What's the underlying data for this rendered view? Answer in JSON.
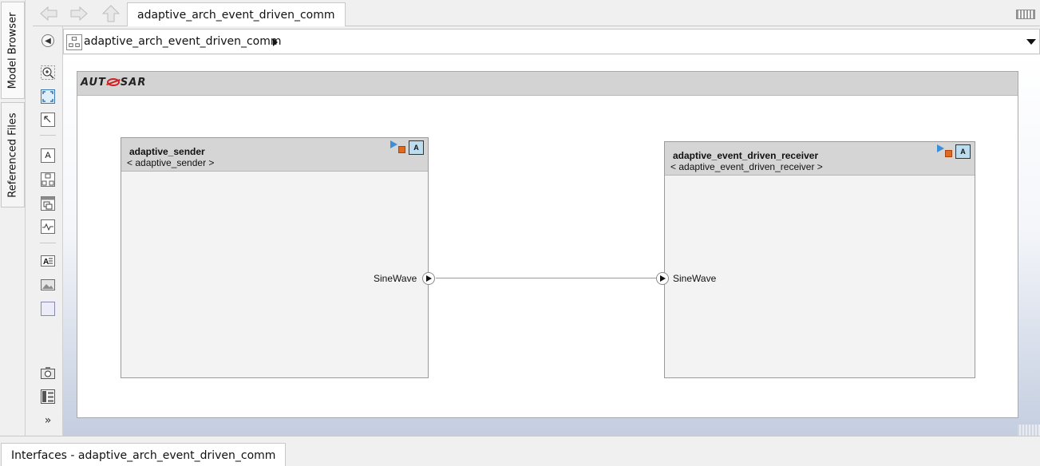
{
  "side_tabs": {
    "model_browser": "Model Browser",
    "referenced_files": "Referenced Files"
  },
  "toolbar": {
    "active_tab": "adaptive_arch_event_driven_comm",
    "nav_icons": [
      "back-arrow-icon",
      "forward-arrow-icon",
      "up-arrow-icon"
    ],
    "right_icon": "keyboard-icon"
  },
  "address_bar": {
    "path": "adaptive_arch_event_driven_comm",
    "model_icon": "model-icon"
  },
  "palette": {
    "tools": [
      "zoom-in-icon",
      "fit-to-view-icon",
      "zoom-normal-icon",
      "annotation-icon",
      "component-icon",
      "reference-component-icon",
      "adapter-icon",
      "image-annotation-icon",
      "area-image-icon",
      "area-icon",
      "screenshot-icon",
      "property-inspector-icon",
      "expand-chevron-icon"
    ]
  },
  "canvas": {
    "header_logo": "AUTOSAR",
    "components": [
      {
        "name": "adaptive_sender",
        "type": "< adaptive_sender >",
        "ports": [
          {
            "label": "SineWave",
            "direction": "out"
          }
        ]
      },
      {
        "name": "adaptive_event_driven_receiver",
        "type": "< adaptive_event_driven_receiver >",
        "ports": [
          {
            "label": "SineWave",
            "direction": "in"
          }
        ]
      }
    ],
    "component_badge": "A",
    "connections": [
      {
        "from": "adaptive_sender.SineWave",
        "to": "adaptive_event_driven_receiver.SineWave"
      }
    ]
  },
  "bottom_panel": {
    "tab_label": "Interfaces - adaptive_arch_event_driven_comm"
  },
  "colors": {
    "canvas_top": "#ffffff",
    "canvas_bottom": "#c4cee0",
    "header_gray": "#d3d3d3",
    "badge_blue": "#bcdcf0",
    "logo_red": "#d02020"
  }
}
